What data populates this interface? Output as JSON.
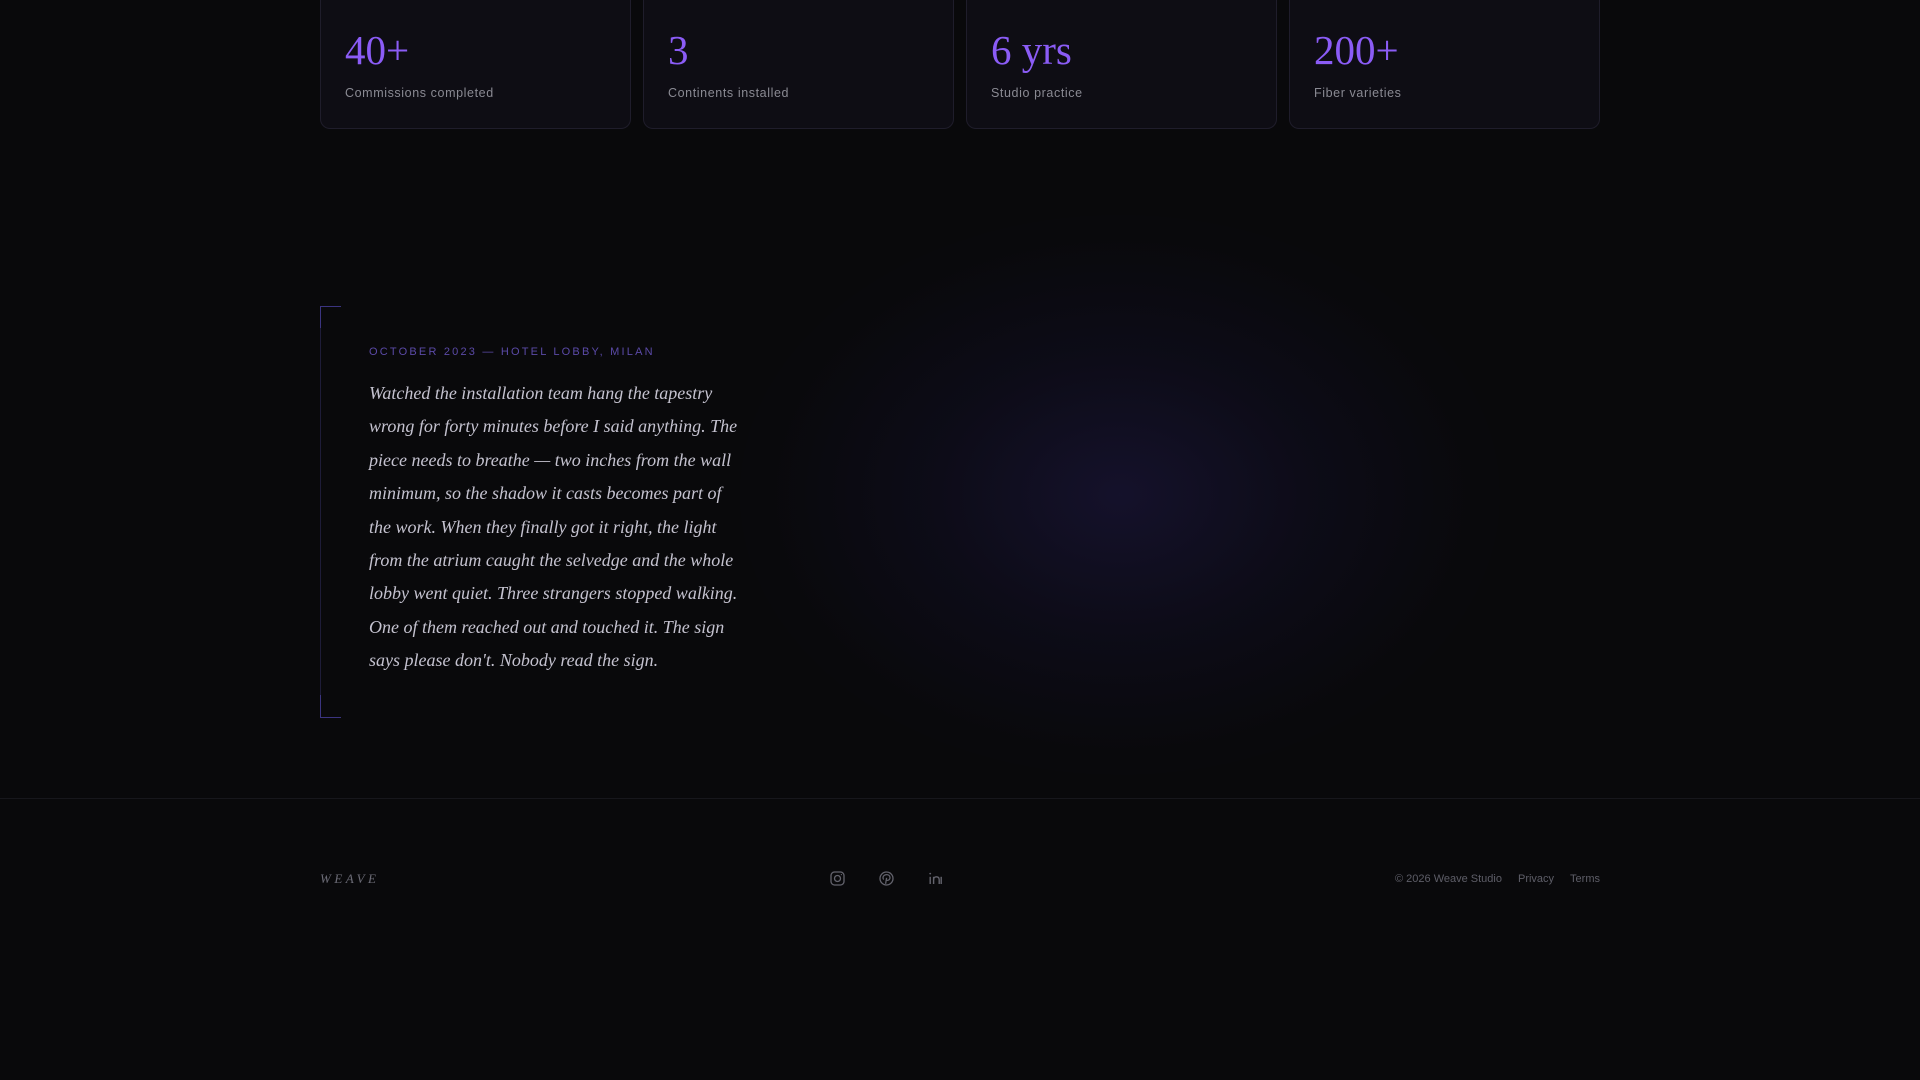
{
  "stats": [
    {
      "value": "40+",
      "label": "Commissions completed"
    },
    {
      "value": "3",
      "label": "Continents installed"
    },
    {
      "value": "6 yrs",
      "label": "Studio practice"
    },
    {
      "value": "200+",
      "label": "Fiber varieties"
    }
  ],
  "journal": {
    "date": "OCTOBER 2023 — HOTEL LOBBY, MILAN",
    "text": "Watched the installation team hang the tapestry wrong for forty minutes before I said anything. The piece needs to breathe — two inches from the wall minimum, so the shadow it casts becomes part of the work. When they finally got it right, the light from the atrium caught the selvedge and the whole lobby went quiet. Three strangers stopped walking. One of them reached out and touched it. The sign says please don't. Nobody read the sign."
  },
  "footer": {
    "brand": "WEAVE",
    "social": [
      "instagram-icon",
      "pinterest-icon",
      "linkedin-icon"
    ],
    "copyright": "© 2026 Weave Studio",
    "privacy_label": "Privacy",
    "terms_label": "Terms"
  },
  "colors": {
    "background": "#09090b",
    "accent": "#8b5cf6",
    "card_border": "#1f1d2b"
  }
}
